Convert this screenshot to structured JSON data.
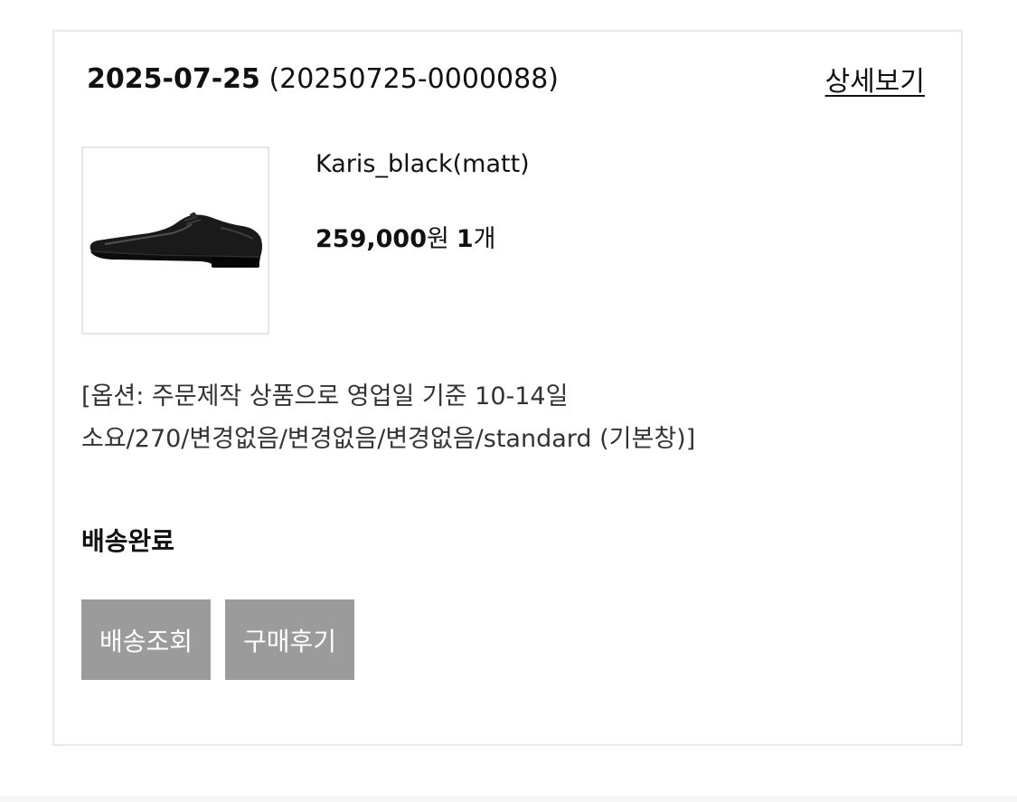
{
  "order": {
    "date": "2025-07-25",
    "number": "(20250725-0000088)",
    "detail_link": "상세보기"
  },
  "product": {
    "image_icon": "shoe-image",
    "name": "Karis_black(matt)",
    "price": "259,000",
    "price_unit": "원",
    "quantity": "1",
    "quantity_unit": "개",
    "option_line1": "[옵션: 주문제작 상품으로 영업일 기준 10-14일",
    "option_line2": "소요/270/변경없음/변경없음/변경없음/standard (기본창)]"
  },
  "status": {
    "label": "배송완료"
  },
  "actions": {
    "track_label": "배송조회",
    "review_label": "구매후기"
  },
  "colors": {
    "button_bg": "#9b9b9b",
    "border": "#e8e8e8"
  }
}
